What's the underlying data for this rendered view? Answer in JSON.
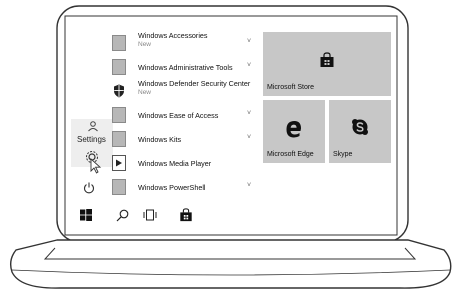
{
  "side_rail": {
    "settings_label": "Settings"
  },
  "apps": [
    {
      "name": "Windows Accessories",
      "sub": "New",
      "chevron": "˅",
      "icon": "folder-tile"
    },
    {
      "name": "Windows Administrative Tools",
      "sub": "",
      "chevron": "˅",
      "icon": "folder-tile"
    },
    {
      "name": "Windows Defender Security Center",
      "sub": "New",
      "chevron": "",
      "icon": "shield-icon"
    },
    {
      "name": "Windows Ease of Access",
      "sub": "",
      "chevron": "˅",
      "icon": "folder-tile"
    },
    {
      "name": "Windows Kits",
      "sub": "",
      "chevron": "˅",
      "icon": "folder-tile"
    },
    {
      "name": "Windows Media Player",
      "sub": "",
      "chevron": "",
      "icon": "media-player-icon"
    },
    {
      "name": "Windows PowerShell",
      "sub": "",
      "chevron": "˅",
      "icon": "folder-tile"
    }
  ],
  "tiles": {
    "store": "Microsoft Store",
    "edge": "Microsoft Edge",
    "skype": "Skype"
  },
  "colors": {
    "tile_bg": "#c7c7c7",
    "outline": "#333333"
  }
}
